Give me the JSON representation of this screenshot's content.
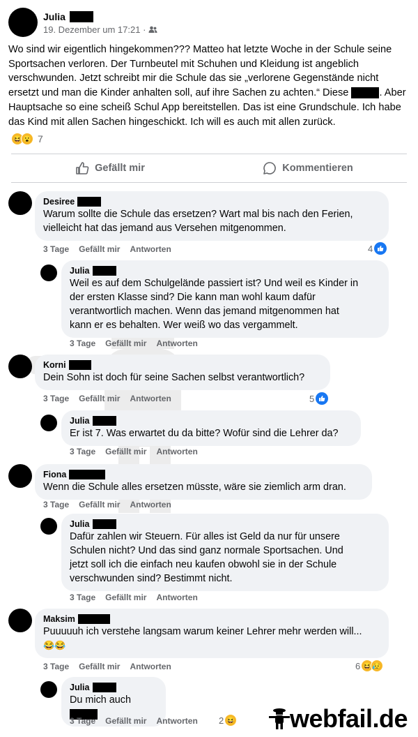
{
  "post": {
    "author": "Julia",
    "date": "19. Dezember um 17:21 ·",
    "text": "Wo sind wir eigentlich hingekommen??? Matteo hat letzte Woche in der Schule seine Sportsachen verloren. Der Turnbeutel mit Schuhen und Kleidung ist angeblich verschwunden. Jetzt schreibt mir die Schule das sie „verlorene Gegenstände nicht ersetzt und man die Kinder anhalten soll, auf ihre Sachen zu achten.“ Diese",
    "text_end": ". Aber Hauptsache so eine scheiß Schul App bereitstellen. Das ist eine Grundschule. Ich habe das Kind mit allen Sachen hingeschickt. Ich will es auch mit allen zurück.",
    "reaction_count": "7",
    "reaction_emojis": [
      "😆",
      "😮"
    ]
  },
  "actions": {
    "like": "Gefällt mir",
    "comment": "Kommentieren"
  },
  "comment_actions": {
    "time": "3 Tage",
    "like": "Gefällt mir",
    "reply": "Antworten"
  },
  "comments": [
    {
      "author": "Desiree",
      "lines": [
        "Warum sollte die Schule das ersetzen? Wart mal bis nach den Ferien,",
        "vielleicht hat das jemand aus Versehen mitgenommen."
      ],
      "reactions": "4"
    },
    {
      "author": "Julia",
      "lines": [
        "Weil es auf dem Schulgelände passiert ist? Und weil es Kinder in",
        "der ersten Klasse sind? Die kann man wohl kaum dafür",
        "verantwortlich machen. Wenn das jemand mitgenommen hat",
        "kann er es behalten. Wer weiß wo das vergammelt."
      ],
      "reactions": ""
    },
    {
      "author": "Korni",
      "lines": [
        "Dein Sohn ist doch für seine Sachen selbst verantwortlich?"
      ],
      "reactions": "5"
    },
    {
      "author": "Julia",
      "lines": [
        "Er ist 7. Was erwartet du da bitte? Wofür sind die Lehrer da?"
      ],
      "reactions": ""
    },
    {
      "author": "Fiona",
      "lines": [
        "Wenn die Schule alles ersetzen müsste, wäre sie ziemlich arm dran."
      ],
      "reactions": ""
    },
    {
      "author": "Julia",
      "lines": [
        "Dafür zahlen wir Steuern. Für alles ist Geld da nur für unsere",
        "Schulen nicht? Und das sind ganz normale Sportsachen. Und",
        "jetzt soll ich die einfach neu kaufen obwohl sie in der Schule",
        "verschwunden sind? Bestimmt nicht."
      ],
      "reactions": ""
    },
    {
      "author": "Maksim",
      "lines": [
        "Puuuuuh ich verstehe langsam warum keiner Lehrer mehr werden will..."
      ],
      "emojis": "😂😂",
      "reactions": "6"
    },
    {
      "author": "Julia",
      "lines": [
        "Du mich auch"
      ],
      "reactions": "2"
    }
  ],
  "watermark": {
    "logo_text": "webfail.de"
  }
}
